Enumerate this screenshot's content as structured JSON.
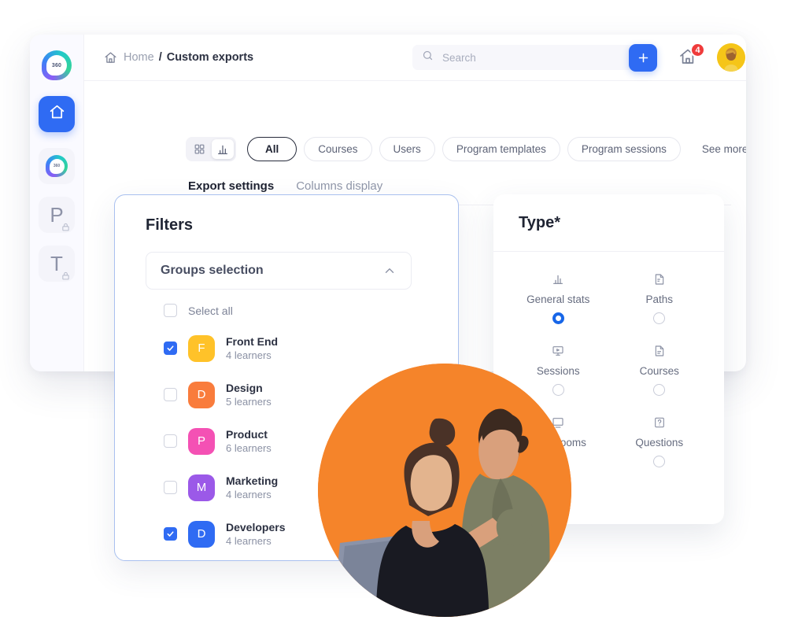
{
  "sidebar": {
    "logo_label": "360",
    "items": [
      {
        "name": "brand-logo",
        "label": "360"
      },
      {
        "name": "home",
        "label": ""
      },
      {
        "name": "app-360",
        "label": "360"
      },
      {
        "name": "programs",
        "label": "P",
        "locked": true
      },
      {
        "name": "trainings",
        "label": "T",
        "locked": true
      }
    ]
  },
  "topbar": {
    "breadcrumb": {
      "home": "Home",
      "separator": "/",
      "current": "Custom exports"
    },
    "search": {
      "placeholder": "Search",
      "value": ""
    },
    "add_button_label": "+",
    "notifications": {
      "count": "4"
    }
  },
  "filters_bar": {
    "view_modes": [
      {
        "label": "grid-view",
        "active": false
      },
      {
        "label": "chart-view",
        "active": true
      }
    ],
    "pills": [
      {
        "label": "All",
        "active": true,
        "plain": false
      },
      {
        "label": "Courses",
        "active": false,
        "plain": false
      },
      {
        "label": "Users",
        "active": false,
        "plain": false
      },
      {
        "label": "Program templates",
        "active": false,
        "plain": false
      },
      {
        "label": "Program sessions",
        "active": false,
        "plain": false
      },
      {
        "label": "See more",
        "active": false,
        "plain": true
      }
    ]
  },
  "tabs": [
    {
      "label": "Export settings",
      "active": true
    },
    {
      "label": "Columns display",
      "active": false
    }
  ],
  "filters_card": {
    "title": "Filters",
    "dropdown": {
      "label": "Groups selection",
      "expanded": true
    },
    "select_all": {
      "label": "Select all",
      "checked": false
    },
    "groups": [
      {
        "name": "Front End",
        "learners": "4 learners",
        "initial": "F",
        "color": "#ffc229",
        "checked": true
      },
      {
        "name": "Design",
        "learners": "5 learners",
        "initial": "D",
        "color": "#f97c3c",
        "checked": false
      },
      {
        "name": "Product",
        "learners": "6 learners",
        "initial": "P",
        "color": "#f martinez",
        "checked": false
      },
      {
        "name": "Marketing",
        "learners": "4 learners",
        "initial": "M",
        "color": "#9b59e8",
        "checked": false
      },
      {
        "name": "Developers",
        "learners": "4 learners",
        "initial": "D",
        "color": "#2f6bf3",
        "checked": true
      }
    ]
  },
  "type_card": {
    "title": "Type*",
    "options": [
      {
        "label": "General stats",
        "icon": "bar-chart-icon",
        "selected": true
      },
      {
        "label": "Paths",
        "icon": "path-document-icon",
        "selected": false
      },
      {
        "label": "Sessions",
        "icon": "monitor-play-icon",
        "selected": false
      },
      {
        "label": "Courses",
        "icon": "course-document-icon",
        "selected": false
      },
      {
        "label": "Classrooms",
        "icon": "classroom-icon",
        "selected": false
      },
      {
        "label": "Questions",
        "icon": "question-box-icon",
        "selected": false
      }
    ]
  },
  "colors": {
    "accent": "#2f6bf3",
    "badge": "#ef3b3b",
    "photo_background": "#f5842a",
    "card_border": "#a9c0ef"
  }
}
